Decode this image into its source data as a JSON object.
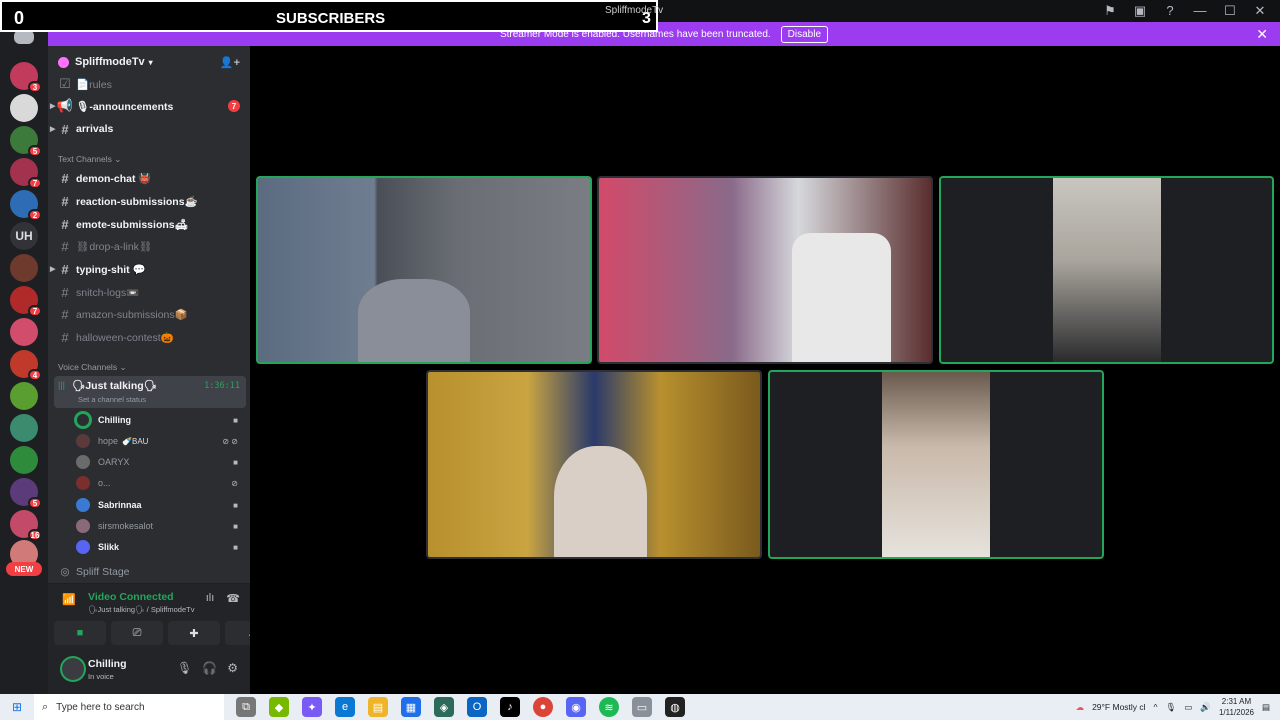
{
  "overlay": {
    "left_count": "0",
    "title": "SUBSCRIBERS",
    "right_count": "3"
  },
  "window": {
    "title": "SpliffmodeTv"
  },
  "banner": {
    "text": "Streamer Mode is enabled. Usernames have been truncated.",
    "button": "Disable"
  },
  "rail": {
    "badges": [
      "3",
      "5",
      "7",
      "2",
      "7",
      "4",
      "5",
      "16"
    ],
    "text_server": "UH",
    "new_label": "NEW"
  },
  "server": {
    "name": "SpliffmodeTv"
  },
  "channels_top": [
    {
      "label": "📄rules"
    },
    {
      "label": "🎙-announcements",
      "badge": "7"
    },
    {
      "label": "arrivals"
    }
  ],
  "text_category": "Text Channels",
  "text_channels": [
    {
      "label": "demon-chat 👹"
    },
    {
      "label": "reaction-submissions☕"
    },
    {
      "label": "emote-submissions🛋"
    },
    {
      "label": "⛓drop-a-link⛓"
    },
    {
      "label": "typing-shit 💬"
    },
    {
      "label": "snitch-logs📼"
    },
    {
      "label": "amazon-submissions📦"
    },
    {
      "label": "halloween-contest🎃"
    }
  ],
  "voice_category": "Voice Channels",
  "voice_channel": {
    "name": "🗣Just talking🗣",
    "time": "1:36:11",
    "status": "Set a channel status"
  },
  "voice_users": [
    {
      "name": "Chilling"
    },
    {
      "name": "hope",
      "tag": "🍼BAU"
    },
    {
      "name": "OARYX"
    },
    {
      "name": "o..."
    },
    {
      "name": "Sabrinnaa"
    },
    {
      "name": "sirsmokesalot"
    },
    {
      "name": "Slikk"
    }
  ],
  "stage_channel": "Spliff Stage",
  "voice_connection": {
    "title": "Video Connected",
    "subtitle": "🗣Just talking🗣 / SpliffmodeTv"
  },
  "user_panel": {
    "name": "Chilling",
    "status": "In voice"
  },
  "taskbar": {
    "search_placeholder": "Type here to search",
    "weather": "29°F  Mostly cl",
    "time": "2:31 AM",
    "date": "1/11/2026"
  },
  "colors": {
    "accent": "#9b3cf0",
    "speaking": "#23a55a",
    "badge": "#f23f43"
  }
}
